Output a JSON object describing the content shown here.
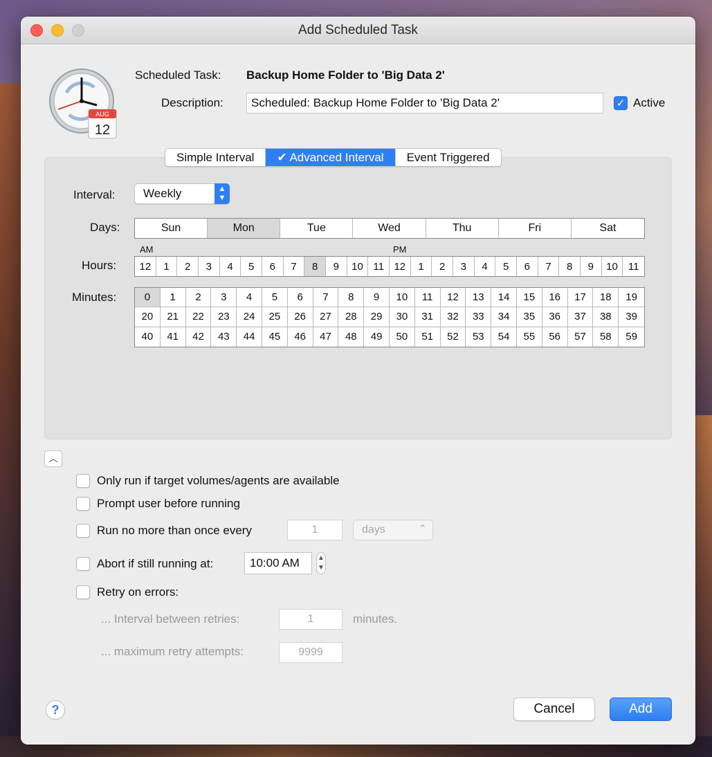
{
  "window": {
    "title": "Add Scheduled Task"
  },
  "task": {
    "label": "Scheduled Task:",
    "name": "Backup Home Folder to 'Big Data 2'",
    "description_label": "Description:",
    "description_value": "Scheduled: Backup Home Folder to 'Big Data 2'",
    "active_label": "Active",
    "active_checked": true
  },
  "icon": {
    "calendar_month": "AUG",
    "calendar_day": "12"
  },
  "tabs": [
    {
      "label": "Simple Interval",
      "selected": false
    },
    {
      "label": "✔ Advanced Interval",
      "selected": true
    },
    {
      "label": "Event Triggered",
      "selected": false
    }
  ],
  "schedule": {
    "interval_label": "Interval:",
    "interval_value": "Weekly",
    "days_label": "Days:",
    "days": [
      "Sun",
      "Mon",
      "Tue",
      "Wed",
      "Thu",
      "Fri",
      "Sat"
    ],
    "days_selected": [
      "Mon"
    ],
    "hours_label": "Hours:",
    "am_label": "AM",
    "pm_label": "PM",
    "hours": [
      "12",
      "1",
      "2",
      "3",
      "4",
      "5",
      "6",
      "7",
      "8",
      "9",
      "10",
      "11",
      "12",
      "1",
      "2",
      "3",
      "4",
      "5",
      "6",
      "7",
      "8",
      "9",
      "10",
      "11"
    ],
    "hours_selected_index": 8,
    "minutes_label": "Minutes:",
    "minutes_selected": 0
  },
  "options": {
    "only_run_label": "Only run if target volumes/agents are available",
    "prompt_label": "Prompt user before running",
    "run_no_more_label": "Run no more than once every",
    "run_no_more_value": "1",
    "run_no_more_unit": "days",
    "abort_label": "Abort if still running at:",
    "abort_time": "10:00 AM",
    "retry_label": "Retry on errors:",
    "retry_interval_label": "... Interval between retries:",
    "retry_interval_value": "1",
    "retry_interval_unit": "minutes.",
    "retry_max_label": "... maximum retry attempts:",
    "retry_max_value": "9999"
  },
  "buttons": {
    "help": "?",
    "cancel": "Cancel",
    "add": "Add"
  },
  "colors": {
    "accent": "#2f7ff3",
    "close": "#fc5f57",
    "minimize": "#fdbc2e",
    "zoom": "#d0d0d0"
  }
}
